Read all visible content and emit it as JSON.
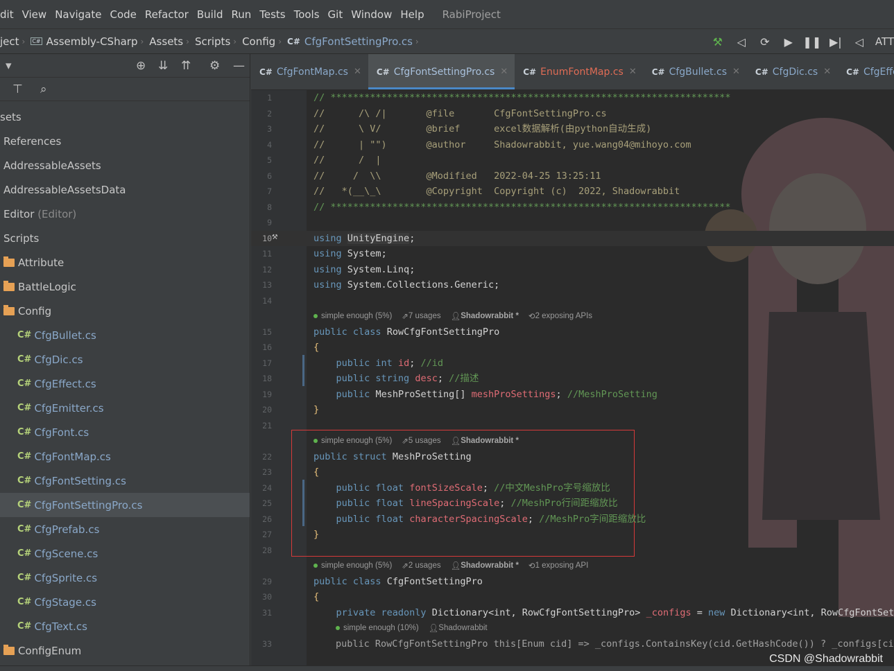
{
  "menubar": {
    "items": [
      "dit",
      "View",
      "Navigate",
      "Code",
      "Refactor",
      "Build",
      "Run",
      "Tests",
      "Tools",
      "Git",
      "Window",
      "Help"
    ],
    "project_title": "RabiProject"
  },
  "navbar": {
    "crumbs": [
      "ject",
      "Assembly-CSharp",
      "Assets",
      "Scripts",
      "Config",
      "CfgFontSettingPro.cs"
    ],
    "att_label": "ATT"
  },
  "sidebar": {
    "tree": [
      {
        "label": "sets",
        "kind": "text"
      },
      {
        "label": "References",
        "kind": "text"
      },
      {
        "label": "AddressableAssets",
        "kind": "text"
      },
      {
        "label": "AddressableAssetsData",
        "kind": "text"
      },
      {
        "label": "Editor",
        "suffix": "(Editor)",
        "kind": "text"
      },
      {
        "label": "Scripts",
        "kind": "text"
      },
      {
        "label": "Attribute",
        "kind": "folder"
      },
      {
        "label": "BattleLogic",
        "kind": "folder"
      },
      {
        "label": "Config",
        "kind": "folder"
      },
      {
        "label": "CfgBullet.cs",
        "kind": "cs"
      },
      {
        "label": "CfgDic.cs",
        "kind": "cs"
      },
      {
        "label": "CfgEffect.cs",
        "kind": "cs"
      },
      {
        "label": "CfgEmitter.cs",
        "kind": "cs"
      },
      {
        "label": "CfgFont.cs",
        "kind": "cs"
      },
      {
        "label": "CfgFontMap.cs",
        "kind": "cs"
      },
      {
        "label": "CfgFontSetting.cs",
        "kind": "cs"
      },
      {
        "label": "CfgFontSettingPro.cs",
        "kind": "cs",
        "selected": true
      },
      {
        "label": "CfgPrefab.cs",
        "kind": "cs"
      },
      {
        "label": "CfgScene.cs",
        "kind": "cs"
      },
      {
        "label": "CfgSprite.cs",
        "kind": "cs"
      },
      {
        "label": "CfgStage.cs",
        "kind": "cs"
      },
      {
        "label": "CfgText.cs",
        "kind": "cs"
      },
      {
        "label": "ConfigEnum",
        "kind": "folder"
      }
    ],
    "cs_badge": "C#"
  },
  "tabs": [
    {
      "label": "CfgFontMap.cs",
      "style": "normal"
    },
    {
      "label": "CfgFontSettingPro.cs",
      "style": "active"
    },
    {
      "label": "EnumFontMap.cs",
      "style": "err"
    },
    {
      "label": "CfgBullet.cs",
      "style": "normal"
    },
    {
      "label": "CfgDic.cs",
      "style": "normal"
    },
    {
      "label": "CfgEffect.cs",
      "style": "normal"
    }
  ],
  "hints": {
    "h1": {
      "complexity": "simple enough (5%)",
      "usages": "7 usages",
      "author": "Shadowrabbit *",
      "api": "2 exposing APIs"
    },
    "h2": {
      "complexity": "simple enough (5%)",
      "usages": "5 usages",
      "author": "Shadowrabbit *"
    },
    "h3": {
      "complexity": "simple enough (5%)",
      "usages": "2 usages",
      "author": "Shadowrabbit *",
      "api": "1 exposing API"
    },
    "h4": {
      "complexity": "simple enough (10%)",
      "author": "Shadowrabbit"
    }
  },
  "code": {
    "l1": "// ***********************************************************************",
    "l2": "//      /\\ /|       @file       CfgFontSettingPro.cs",
    "l3": "//      \\ V/        @brief      excel数据解析(由python自动生成)",
    "l4": "//      | \"\")       @author     Shadowrabbit, yue.wang04@mihoyo.com",
    "l5": "//      /  |",
    "l6": "//     /  \\\\        @Modified   2022-04-25 13:25:11",
    "l7": "//   *(__\\_\\        @Copyright  Copyright (c)  2022, Shadowrabbit",
    "l8": "// ***********************************************************************",
    "l10_kw": "using",
    "l10_ns": "UnityEngine",
    "l11": "System",
    "l12": "System.Linq",
    "l13": "System.Collections.Generic",
    "l15_class": "RowCfgFontSettingPro",
    "l17_field": "id",
    "l17_com": "//id",
    "l18_field": "desc",
    "l18_com": "//描述",
    "l19_type": "MeshProSetting[]",
    "l19_field": "meshProSettings",
    "l19_com": "//MeshProSetting",
    "l22_struct": "MeshProSetting",
    "l24_field": "fontSizeScale",
    "l24_com": "//中文MeshPro字号缩放比",
    "l25_field": "lineSpacingScale",
    "l25_com": "//MeshPro行间距缩放比",
    "l26_field": "characterSpacingScale",
    "l26_com": "//MeshPro字间距缩放比",
    "l29_class": "CfgFontSettingPro",
    "l31_type": "Dictionary<int, RowCfgFontSettingPro>",
    "l31_field": "_configs",
    "l31_rest": "Dictionary<int, RowCfgFontSetti",
    "l33": "public RowCfgFontSettingPro this[Enum cid] => _configs.ContainsKey(cid.GetHashCode()) ? _configs[cid"
  },
  "line_numbers": [
    "1",
    "2",
    "3",
    "4",
    "5",
    "6",
    "7",
    "8",
    "9",
    "10",
    "11",
    "12",
    "13",
    "14",
    "15",
    "16",
    "17",
    "18",
    "19",
    "20",
    "21",
    "22",
    "23",
    "24",
    "25",
    "26",
    "27",
    "28",
    "29",
    "30",
    "31",
    "33"
  ],
  "watermark": "CSDN @Shadowrabbit"
}
